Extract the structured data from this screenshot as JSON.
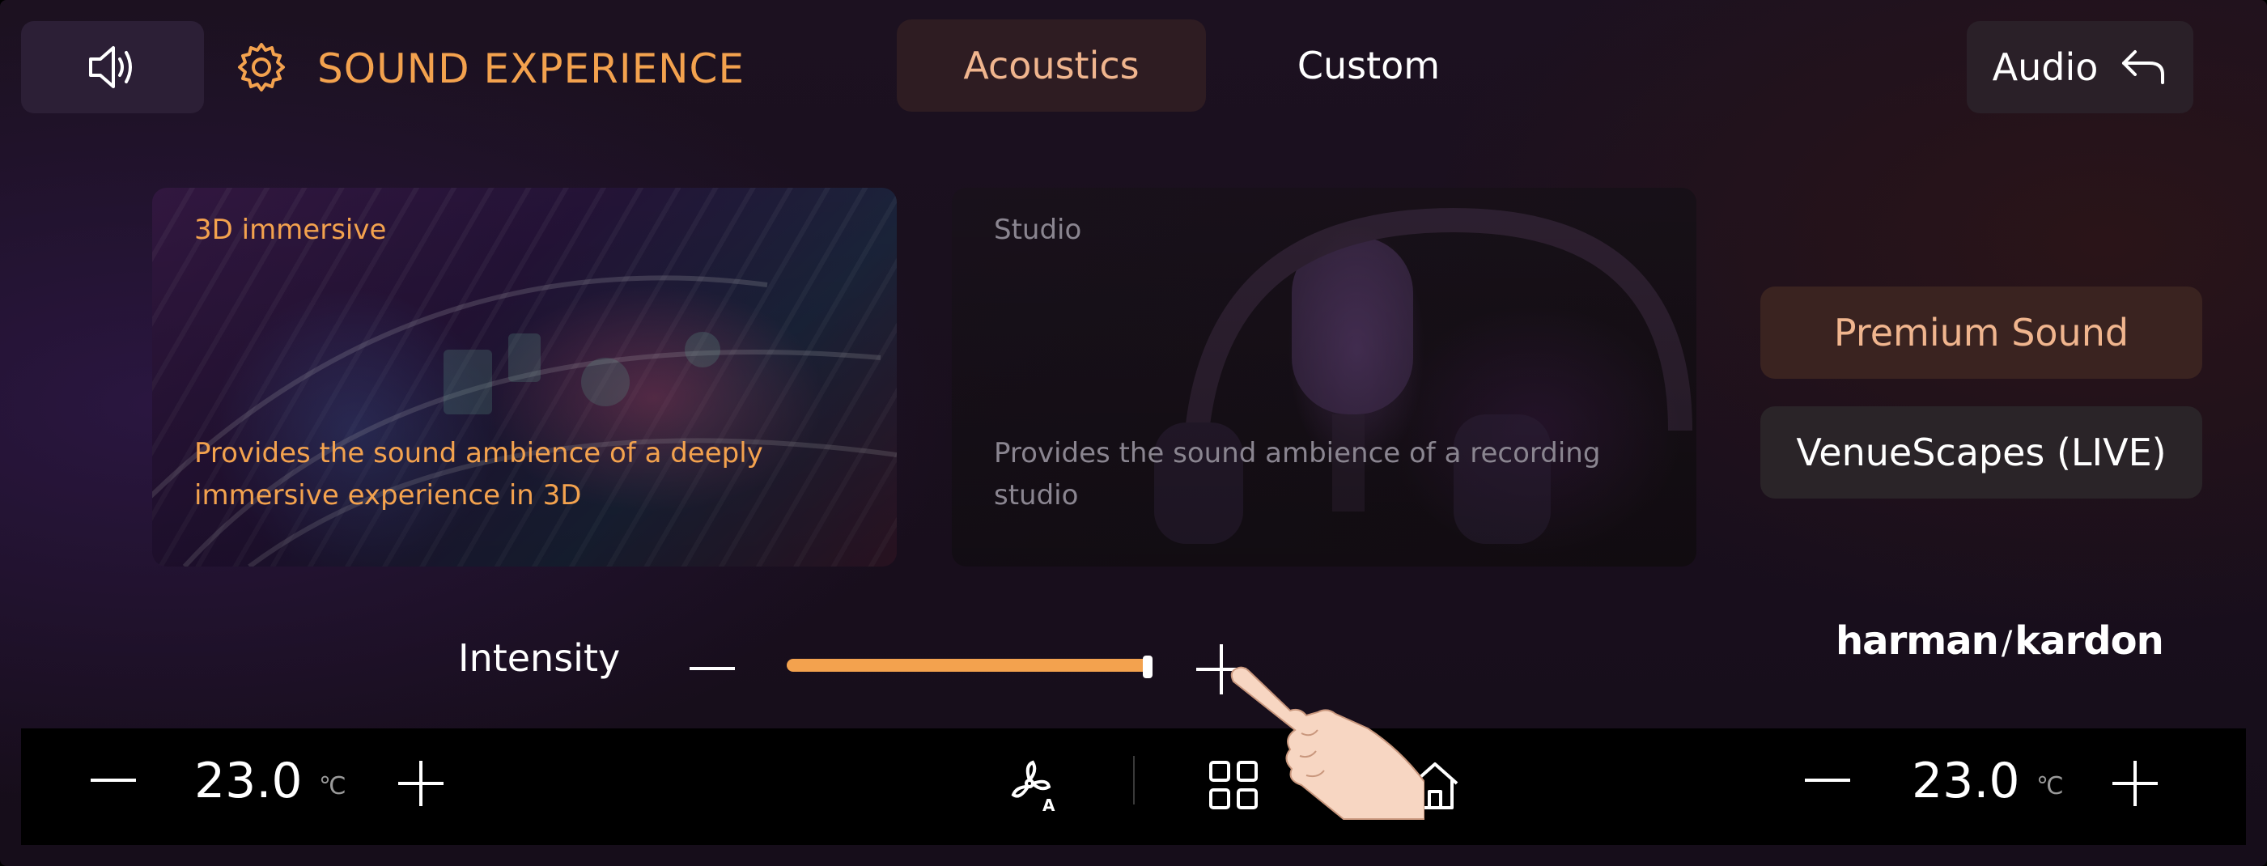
{
  "header": {
    "volume_icon": "speaker-icon",
    "settings_icon": "gear-icon",
    "title": "SOUND EXPERIENCE",
    "tabs": [
      {
        "label": "Acoustics",
        "active": true
      },
      {
        "label": "Custom",
        "active": false
      }
    ],
    "audio_button": {
      "label": "Audio",
      "icon": "back-arrow-icon"
    }
  },
  "modes": [
    {
      "label": "3D immersive",
      "description": "Provides the sound ambience of a deeply immersive experience in 3D",
      "selected": true
    },
    {
      "label": "Studio",
      "description": "Provides the sound ambience of a recording studio",
      "selected": false
    }
  ],
  "side_options": [
    {
      "label": "Premium Sound",
      "selected": true
    },
    {
      "label": "VenueScapes (LIVE)",
      "selected": false
    }
  ],
  "brand": "harman/kardon",
  "intensity": {
    "label": "Intensity",
    "value_fraction": 1.0
  },
  "climate": {
    "left": {
      "temperature": "23.0",
      "unit": "℃"
    },
    "right": {
      "temperature": "23.0",
      "unit": "℃"
    },
    "icons": [
      "fan-auto-icon",
      "apps-grid-icon",
      "home-icon"
    ]
  },
  "colors": {
    "accent": "#f3a24e",
    "active_tab_text": "#f0b58e",
    "inactive_text": "#8a8590"
  }
}
